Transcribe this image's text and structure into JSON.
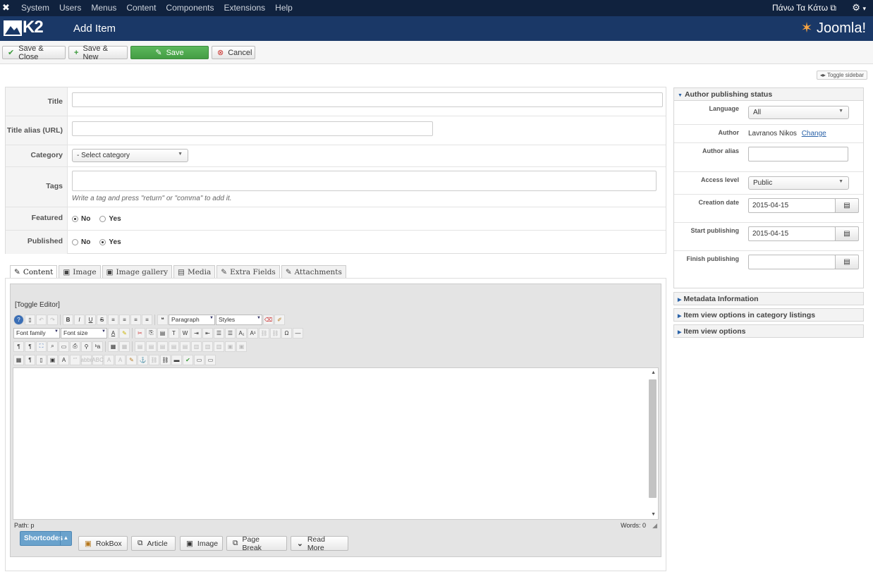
{
  "topbar": {
    "menu": [
      "System",
      "Users",
      "Menus",
      "Content",
      "Components",
      "Extensions",
      "Help"
    ],
    "site_name": "Πάνω Τα Κάτω",
    "gear_caret": "▾"
  },
  "header": {
    "logo_text": "K2",
    "page_title": "Add Item",
    "brand": "Joomla!"
  },
  "toolbar": {
    "save_close": "Save & Close",
    "save_new": "Save & New",
    "save": "Save",
    "cancel": "Cancel",
    "toggle_sidebar": "Toggle sidebar"
  },
  "form": {
    "title_label": "Title",
    "alias_label": "Title alias (URL)",
    "category_label": "Category",
    "category_value": "- Select category",
    "tags_label": "Tags",
    "tags_hint": "Write a tag and press \"return\" or \"comma\" to add it.",
    "featured_label": "Featured",
    "published_label": "Published",
    "no": "No",
    "yes": "Yes",
    "featured_value": "No",
    "published_value": "Yes"
  },
  "tabs": [
    "Content",
    "Image",
    "Image gallery",
    "Media",
    "Extra Fields",
    "Attachments"
  ],
  "tab_icons": [
    "✎",
    "▣",
    "▣",
    "▤",
    "✎",
    "✎"
  ],
  "editor": {
    "toggle": "[Toggle Editor]",
    "format_select": "Paragraph",
    "styles_select": "Styles",
    "font_family": "Font family",
    "font_size": "Font size",
    "path": "Path: p",
    "words": "Words: 0"
  },
  "editor_buttons": {
    "shortcodes": "Shortcodes",
    "rokbox": "RokBox",
    "article": "Article",
    "image": "Image",
    "page_break": "Page Break",
    "read_more": "Read More"
  },
  "sidebar": {
    "section1": "Author publishing status",
    "language_label": "Language",
    "language_value": "All",
    "author_label": "Author",
    "author_value": "Lavranos Nikos",
    "author_change": "Change",
    "author_alias_label": "Author alias",
    "access_label": "Access level",
    "access_value": "Public",
    "creation_label": "Creation date",
    "creation_value": "2015-04-15",
    "start_label": "Start publishing",
    "start_value": "2015-04-15",
    "finish_label": "Finish publishing",
    "finish_value": "",
    "section2": "Metadata Information",
    "section3": "Item view options in category listings",
    "section4": "Item view options"
  }
}
